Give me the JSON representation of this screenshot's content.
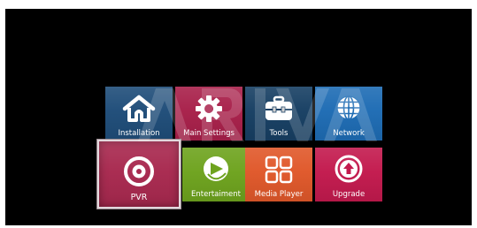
{
  "menu": {
    "tiles": [
      {
        "label": "Installation",
        "icon": "home-icon",
        "color": "#1f4d79",
        "selected": false
      },
      {
        "label": "Main Settings",
        "icon": "gear-icon",
        "color": "#a8204a",
        "selected": false
      },
      {
        "label": "Tools",
        "icon": "toolbox-icon",
        "color": "#173f63",
        "selected": false
      },
      {
        "label": "Network",
        "icon": "globe-icon",
        "color": "#1e6cb4",
        "selected": false
      },
      {
        "label": "PVR",
        "icon": "record-icon",
        "color": "#a8294f",
        "selected": true
      },
      {
        "label": "Entertaiment",
        "icon": "play-icon",
        "color": "#6ea31e",
        "selected": false
      },
      {
        "label": "Media Player",
        "icon": "tiles-icon",
        "color": "#e0582a",
        "selected": false
      },
      {
        "label": "Upgrade",
        "icon": "upload-icon",
        "color": "#c31a4e",
        "selected": false
      }
    ]
  },
  "watermark": {
    "text": "ARIVA",
    "icon": "brand-watermark"
  }
}
